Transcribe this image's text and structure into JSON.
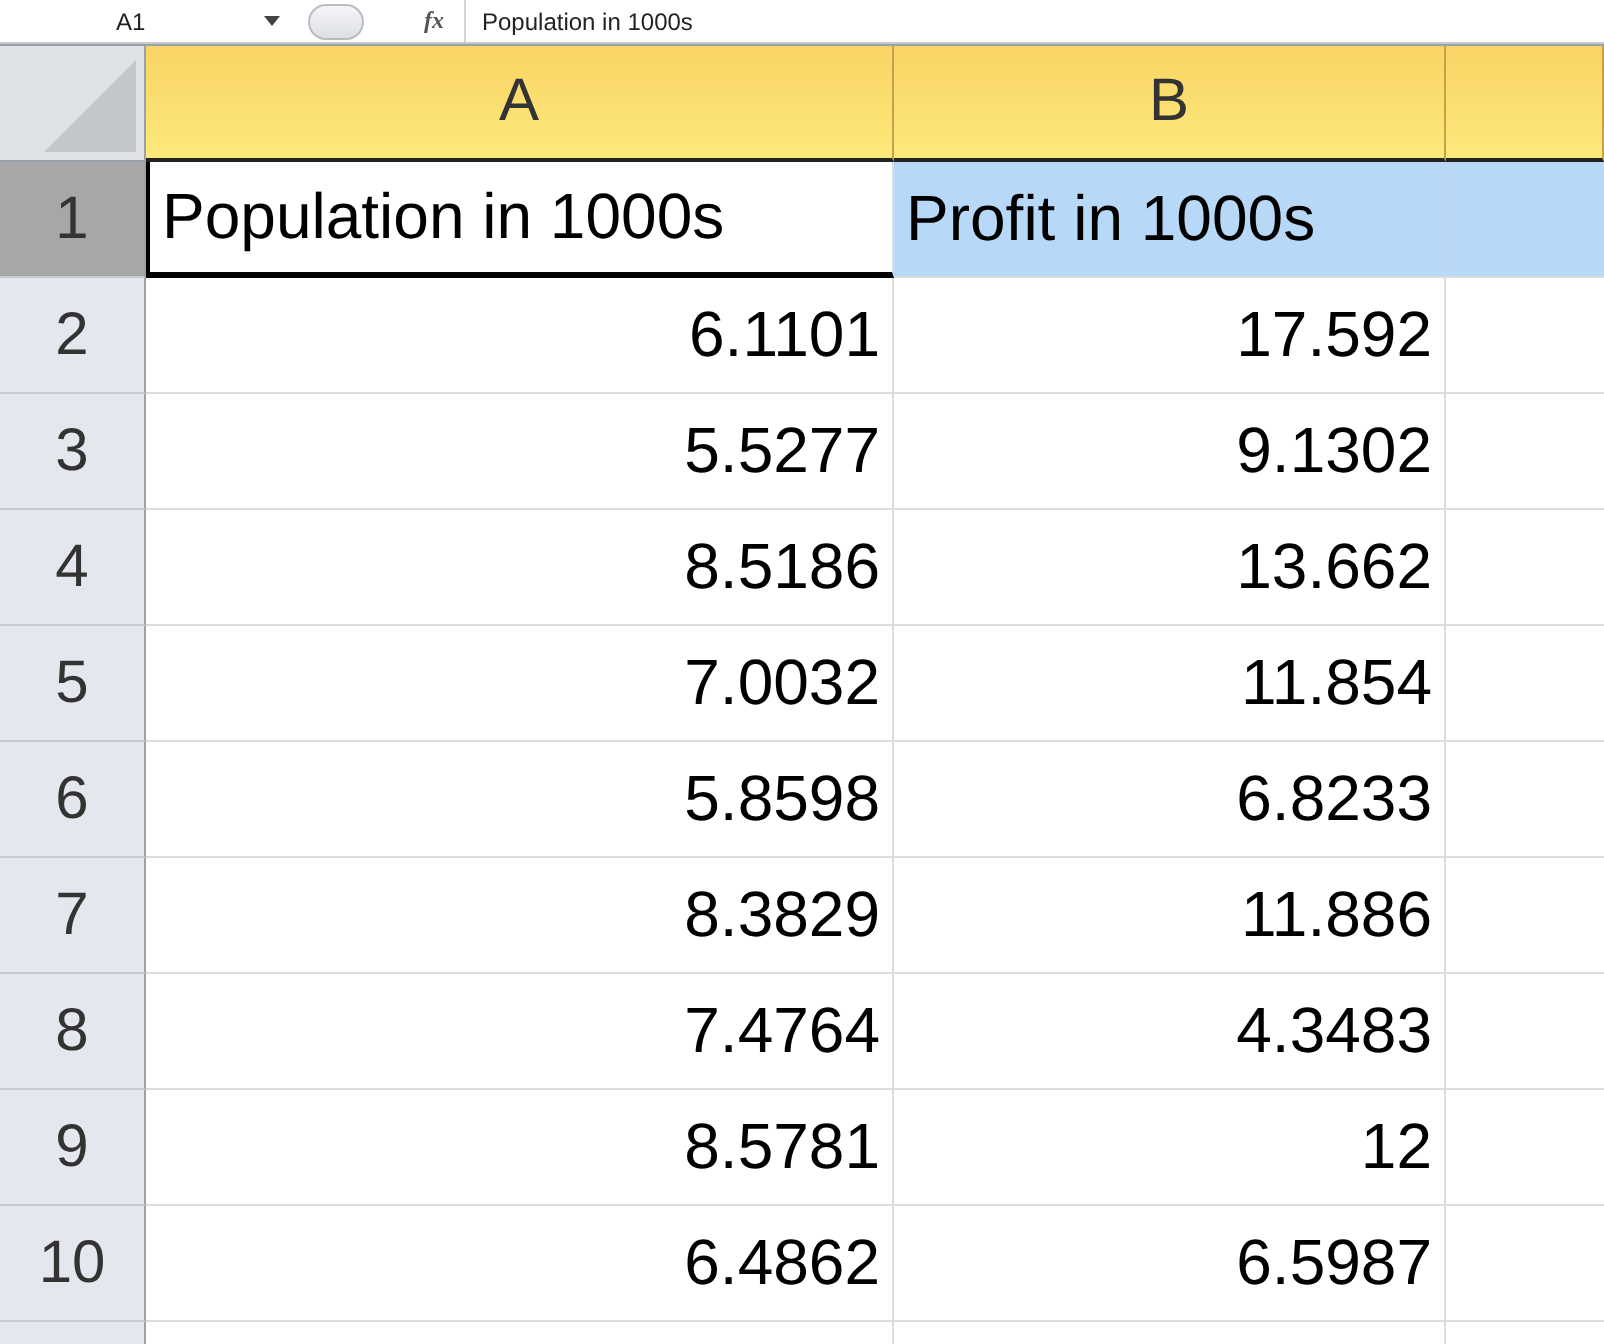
{
  "formula_bar": {
    "name_box": "A1",
    "fx": "fx",
    "formula": "Population in 1000s"
  },
  "columns": [
    {
      "label": "A",
      "selected": true
    },
    {
      "label": "B",
      "selected": true
    }
  ],
  "rows": [
    {
      "number": "1",
      "selected": true,
      "cells": [
        {
          "text": "Population in 1000s",
          "active": true,
          "kind": "text"
        },
        {
          "text": "Profit in 1000s",
          "active": false,
          "kind": "text"
        }
      ]
    },
    {
      "number": "2",
      "selected": false,
      "cells": [
        {
          "text": "6.1101",
          "active": false
        },
        {
          "text": "17.592",
          "active": false
        }
      ]
    },
    {
      "number": "3",
      "selected": false,
      "cells": [
        {
          "text": "5.5277",
          "active": false
        },
        {
          "text": "9.1302",
          "active": false
        }
      ]
    },
    {
      "number": "4",
      "selected": false,
      "cells": [
        {
          "text": "8.5186",
          "active": false
        },
        {
          "text": "13.662",
          "active": false
        }
      ]
    },
    {
      "number": "5",
      "selected": false,
      "cells": [
        {
          "text": "7.0032",
          "active": false
        },
        {
          "text": "11.854",
          "active": false
        }
      ]
    },
    {
      "number": "6",
      "selected": false,
      "cells": [
        {
          "text": "5.8598",
          "active": false
        },
        {
          "text": "6.8233",
          "active": false
        }
      ]
    },
    {
      "number": "7",
      "selected": false,
      "cells": [
        {
          "text": "8.3829",
          "active": false
        },
        {
          "text": "11.886",
          "active": false
        }
      ]
    },
    {
      "number": "8",
      "selected": false,
      "cells": [
        {
          "text": "7.4764",
          "active": false
        },
        {
          "text": "4.3483",
          "active": false
        }
      ]
    },
    {
      "number": "9",
      "selected": false,
      "cells": [
        {
          "text": "8.5781",
          "active": false
        },
        {
          "text": "12",
          "active": false
        }
      ]
    },
    {
      "number": "10",
      "selected": false,
      "cells": [
        {
          "text": "6.4862",
          "active": false
        },
        {
          "text": "6.5987",
          "active": false
        }
      ]
    }
  ]
}
